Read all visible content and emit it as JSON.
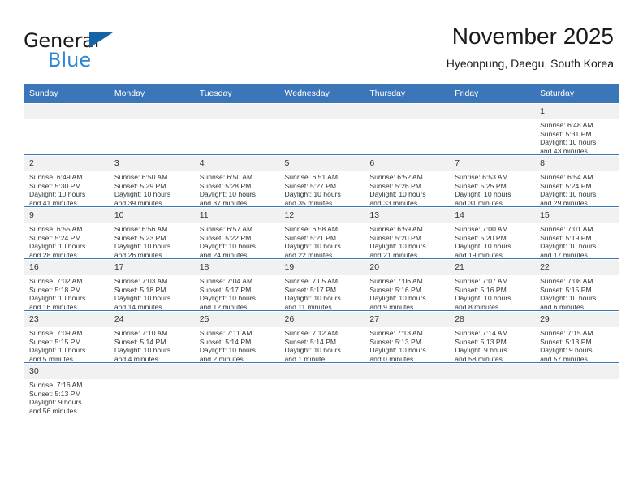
{
  "brand": {
    "name_top": "General",
    "name_bottom": "Blue",
    "triangle_color": "#1464a5",
    "blue_color": "#2c87d4"
  },
  "header": {
    "title": "November 2025",
    "subtitle": "Hyeonpung, Daegu, South Korea"
  },
  "theme": {
    "header_blue": "#3b76b8",
    "daynum_gray": "#f1f1f1",
    "row_rule": "#3b76b8"
  },
  "calendar": {
    "weekday_headers": [
      "Sunday",
      "Monday",
      "Tuesday",
      "Wednesday",
      "Thursday",
      "Friday",
      "Saturday"
    ],
    "weeks": [
      [
        {
          "day": "",
          "empty": true
        },
        {
          "day": "",
          "empty": true
        },
        {
          "day": "",
          "empty": true
        },
        {
          "day": "",
          "empty": true
        },
        {
          "day": "",
          "empty": true
        },
        {
          "day": "",
          "empty": true
        },
        {
          "day": "1",
          "sunrise": "Sunrise: 6:48 AM",
          "sunset": "Sunset: 5:31 PM",
          "daylight_line1": "Daylight: 10 hours",
          "daylight_line2": "and 43 minutes."
        }
      ],
      [
        {
          "day": "2",
          "sunrise": "Sunrise: 6:49 AM",
          "sunset": "Sunset: 5:30 PM",
          "daylight_line1": "Daylight: 10 hours",
          "daylight_line2": "and 41 minutes."
        },
        {
          "day": "3",
          "sunrise": "Sunrise: 6:50 AM",
          "sunset": "Sunset: 5:29 PM",
          "daylight_line1": "Daylight: 10 hours",
          "daylight_line2": "and 39 minutes."
        },
        {
          "day": "4",
          "sunrise": "Sunrise: 6:50 AM",
          "sunset": "Sunset: 5:28 PM",
          "daylight_line1": "Daylight: 10 hours",
          "daylight_line2": "and 37 minutes."
        },
        {
          "day": "5",
          "sunrise": "Sunrise: 6:51 AM",
          "sunset": "Sunset: 5:27 PM",
          "daylight_line1": "Daylight: 10 hours",
          "daylight_line2": "and 35 minutes."
        },
        {
          "day": "6",
          "sunrise": "Sunrise: 6:52 AM",
          "sunset": "Sunset: 5:26 PM",
          "daylight_line1": "Daylight: 10 hours",
          "daylight_line2": "and 33 minutes."
        },
        {
          "day": "7",
          "sunrise": "Sunrise: 6:53 AM",
          "sunset": "Sunset: 5:25 PM",
          "daylight_line1": "Daylight: 10 hours",
          "daylight_line2": "and 31 minutes."
        },
        {
          "day": "8",
          "sunrise": "Sunrise: 6:54 AM",
          "sunset": "Sunset: 5:24 PM",
          "daylight_line1": "Daylight: 10 hours",
          "daylight_line2": "and 29 minutes."
        }
      ],
      [
        {
          "day": "9",
          "sunrise": "Sunrise: 6:55 AM",
          "sunset": "Sunset: 5:24 PM",
          "daylight_line1": "Daylight: 10 hours",
          "daylight_line2": "and 28 minutes."
        },
        {
          "day": "10",
          "sunrise": "Sunrise: 6:56 AM",
          "sunset": "Sunset: 5:23 PM",
          "daylight_line1": "Daylight: 10 hours",
          "daylight_line2": "and 26 minutes."
        },
        {
          "day": "11",
          "sunrise": "Sunrise: 6:57 AM",
          "sunset": "Sunset: 5:22 PM",
          "daylight_line1": "Daylight: 10 hours",
          "daylight_line2": "and 24 minutes."
        },
        {
          "day": "12",
          "sunrise": "Sunrise: 6:58 AM",
          "sunset": "Sunset: 5:21 PM",
          "daylight_line1": "Daylight: 10 hours",
          "daylight_line2": "and 22 minutes."
        },
        {
          "day": "13",
          "sunrise": "Sunrise: 6:59 AM",
          "sunset": "Sunset: 5:20 PM",
          "daylight_line1": "Daylight: 10 hours",
          "daylight_line2": "and 21 minutes."
        },
        {
          "day": "14",
          "sunrise": "Sunrise: 7:00 AM",
          "sunset": "Sunset: 5:20 PM",
          "daylight_line1": "Daylight: 10 hours",
          "daylight_line2": "and 19 minutes."
        },
        {
          "day": "15",
          "sunrise": "Sunrise: 7:01 AM",
          "sunset": "Sunset: 5:19 PM",
          "daylight_line1": "Daylight: 10 hours",
          "daylight_line2": "and 17 minutes."
        }
      ],
      [
        {
          "day": "16",
          "sunrise": "Sunrise: 7:02 AM",
          "sunset": "Sunset: 5:18 PM",
          "daylight_line1": "Daylight: 10 hours",
          "daylight_line2": "and 16 minutes."
        },
        {
          "day": "17",
          "sunrise": "Sunrise: 7:03 AM",
          "sunset": "Sunset: 5:18 PM",
          "daylight_line1": "Daylight: 10 hours",
          "daylight_line2": "and 14 minutes."
        },
        {
          "day": "18",
          "sunrise": "Sunrise: 7:04 AM",
          "sunset": "Sunset: 5:17 PM",
          "daylight_line1": "Daylight: 10 hours",
          "daylight_line2": "and 12 minutes."
        },
        {
          "day": "19",
          "sunrise": "Sunrise: 7:05 AM",
          "sunset": "Sunset: 5:17 PM",
          "daylight_line1": "Daylight: 10 hours",
          "daylight_line2": "and 11 minutes."
        },
        {
          "day": "20",
          "sunrise": "Sunrise: 7:06 AM",
          "sunset": "Sunset: 5:16 PM",
          "daylight_line1": "Daylight: 10 hours",
          "daylight_line2": "and 9 minutes."
        },
        {
          "day": "21",
          "sunrise": "Sunrise: 7:07 AM",
          "sunset": "Sunset: 5:16 PM",
          "daylight_line1": "Daylight: 10 hours",
          "daylight_line2": "and 8 minutes."
        },
        {
          "day": "22",
          "sunrise": "Sunrise: 7:08 AM",
          "sunset": "Sunset: 5:15 PM",
          "daylight_line1": "Daylight: 10 hours",
          "daylight_line2": "and 6 minutes."
        }
      ],
      [
        {
          "day": "23",
          "sunrise": "Sunrise: 7:09 AM",
          "sunset": "Sunset: 5:15 PM",
          "daylight_line1": "Daylight: 10 hours",
          "daylight_line2": "and 5 minutes."
        },
        {
          "day": "24",
          "sunrise": "Sunrise: 7:10 AM",
          "sunset": "Sunset: 5:14 PM",
          "daylight_line1": "Daylight: 10 hours",
          "daylight_line2": "and 4 minutes."
        },
        {
          "day": "25",
          "sunrise": "Sunrise: 7:11 AM",
          "sunset": "Sunset: 5:14 PM",
          "daylight_line1": "Daylight: 10 hours",
          "daylight_line2": "and 2 minutes."
        },
        {
          "day": "26",
          "sunrise": "Sunrise: 7:12 AM",
          "sunset": "Sunset: 5:14 PM",
          "daylight_line1": "Daylight: 10 hours",
          "daylight_line2": "and 1 minute."
        },
        {
          "day": "27",
          "sunrise": "Sunrise: 7:13 AM",
          "sunset": "Sunset: 5:13 PM",
          "daylight_line1": "Daylight: 10 hours",
          "daylight_line2": "and 0 minutes."
        },
        {
          "day": "28",
          "sunrise": "Sunrise: 7:14 AM",
          "sunset": "Sunset: 5:13 PM",
          "daylight_line1": "Daylight: 9 hours",
          "daylight_line2": "and 58 minutes."
        },
        {
          "day": "29",
          "sunrise": "Sunrise: 7:15 AM",
          "sunset": "Sunset: 5:13 PM",
          "daylight_line1": "Daylight: 9 hours",
          "daylight_line2": "and 57 minutes."
        }
      ],
      [
        {
          "day": "30",
          "sunrise": "Sunrise: 7:16 AM",
          "sunset": "Sunset: 5:13 PM",
          "daylight_line1": "Daylight: 9 hours",
          "daylight_line2": "and 56 minutes."
        },
        {
          "day": "",
          "empty": true
        },
        {
          "day": "",
          "empty": true
        },
        {
          "day": "",
          "empty": true
        },
        {
          "day": "",
          "empty": true
        },
        {
          "day": "",
          "empty": true
        },
        {
          "day": "",
          "empty": true
        }
      ]
    ]
  }
}
